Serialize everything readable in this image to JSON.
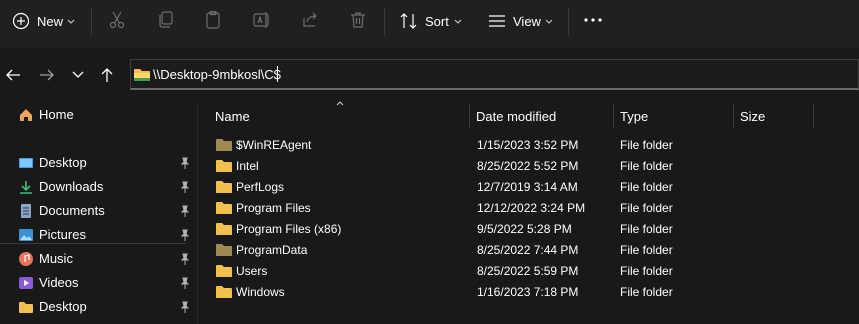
{
  "toolbar": {
    "new_label": "New",
    "sort_label": "Sort",
    "view_label": "View"
  },
  "address": {
    "path": "\\\\Desktop-9mbkosl\\C$"
  },
  "sidebar": {
    "home": "Home",
    "items": [
      {
        "label": "Desktop",
        "icon": "desktop-icon"
      },
      {
        "label": "Downloads",
        "icon": "download-icon"
      },
      {
        "label": "Documents",
        "icon": "document-icon"
      },
      {
        "label": "Pictures",
        "icon": "picture-icon"
      },
      {
        "label": "Music",
        "icon": "music-icon"
      },
      {
        "label": "Videos",
        "icon": "video-icon"
      },
      {
        "label": "Desktop",
        "icon": "folder-icon"
      }
    ]
  },
  "columns": {
    "name": "Name",
    "date": "Date modified",
    "type": "Type",
    "size": "Size"
  },
  "files": [
    {
      "name": "$WinREAgent",
      "date": "1/15/2023 3:52 PM",
      "type": "File folder",
      "dim": true
    },
    {
      "name": "Intel",
      "date": "8/25/2022 5:52 PM",
      "type": "File folder",
      "dim": false
    },
    {
      "name": "PerfLogs",
      "date": "12/7/2019 3:14 AM",
      "type": "File folder",
      "dim": false
    },
    {
      "name": "Program Files",
      "date": "12/12/2022 3:24 PM",
      "type": "File folder",
      "dim": false
    },
    {
      "name": "Program Files (x86)",
      "date": "9/5/2022 5:28 PM",
      "type": "File folder",
      "dim": false
    },
    {
      "name": "ProgramData",
      "date": "8/25/2022 7:44 PM",
      "type": "File folder",
      "dim": true
    },
    {
      "name": "Users",
      "date": "8/25/2022 5:59 PM",
      "type": "File folder",
      "dim": false
    },
    {
      "name": "Windows",
      "date": "1/16/2023 7:18 PM",
      "type": "File folder",
      "dim": false
    }
  ],
  "colors": {
    "folder": "#f2c14e",
    "folder_dim": "#a08a55",
    "background": "#191919",
    "command_bar": "#202020"
  }
}
